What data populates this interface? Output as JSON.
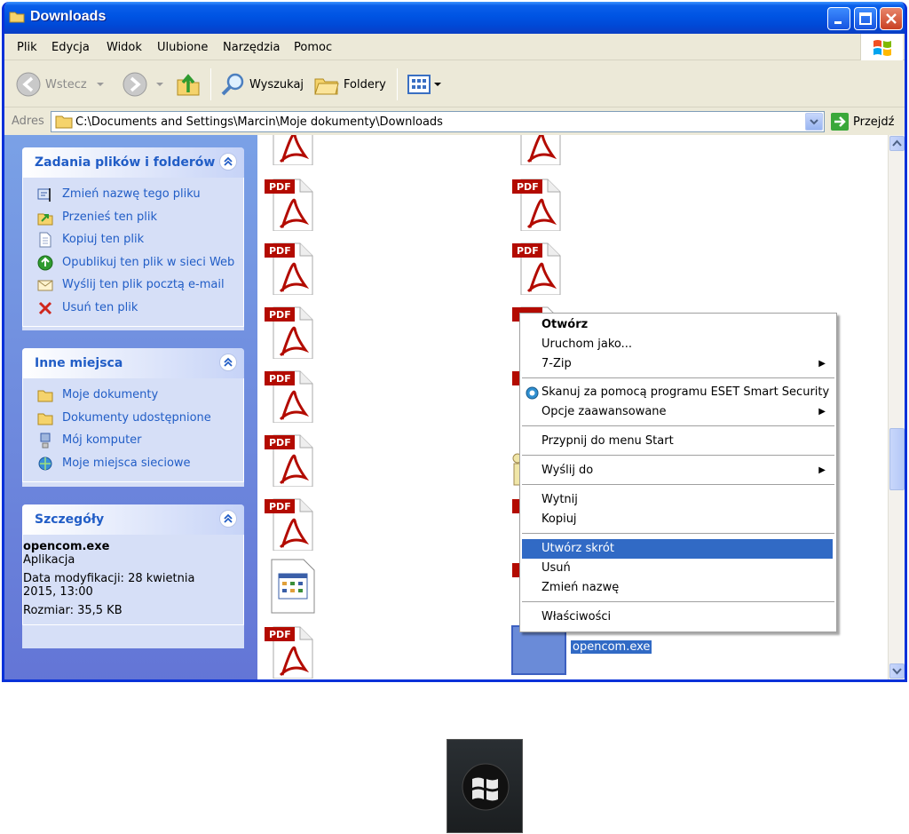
{
  "window": {
    "title": "Downloads"
  },
  "menu": {
    "items": [
      "Plik",
      "Edycja",
      "Widok",
      "Ulubione",
      "Narzędzia",
      "Pomoc"
    ]
  },
  "toolbar": {
    "back_label": "Wstecz",
    "search_label": "Wyszukaj",
    "folders_label": "Foldery"
  },
  "address": {
    "label": "Adres",
    "path": "C:\\Documents and Settings\\Marcin\\Moje dokumenty\\Downloads",
    "go_label": "Przejdź"
  },
  "tasks_panel": {
    "title": "Zadania plików i folderów",
    "items": [
      {
        "label": "Zmień nazwę tego pliku",
        "icon": "rename-icon"
      },
      {
        "label": "Przenieś ten plik",
        "icon": "move-icon"
      },
      {
        "label": "Kopiuj ten plik",
        "icon": "copy-icon"
      },
      {
        "label": "Opublikuj ten plik w sieci Web",
        "icon": "publish-web-icon"
      },
      {
        "label": "Wyślij ten plik pocztą e-mail",
        "icon": "email-icon"
      },
      {
        "label": "Usuń ten plik",
        "icon": "delete-icon"
      }
    ]
  },
  "places_panel": {
    "title": "Inne miejsca",
    "items": [
      {
        "label": "Moje dokumenty",
        "icon": "folder-icon"
      },
      {
        "label": "Dokumenty udostępnione",
        "icon": "folder-icon"
      },
      {
        "label": "Mój komputer",
        "icon": "computer-icon"
      },
      {
        "label": "Moje miejsca sieciowe",
        "icon": "network-icon"
      }
    ]
  },
  "details_panel": {
    "title": "Szczegóły",
    "filename": "opencom.exe",
    "type": "Aplikacja",
    "modified": "Data modyfikacji: 28 kwietnia 2015, 13:00",
    "size": "Rozmiar: 35,5 KB"
  },
  "files": {
    "pdf_badge": "PDF",
    "selected_label": "opencom.exe"
  },
  "context_menu": {
    "items": [
      {
        "label": "Otwórz",
        "bold": true
      },
      {
        "label": "Uruchom jako..."
      },
      {
        "label": "7-Zip",
        "submenu": true
      },
      {
        "label": "Skanuj za pomocą programu ESET Smart Security",
        "icon": "eset-icon"
      },
      {
        "label": "Opcje zaawansowane",
        "submenu": true
      },
      {
        "label": "Przypnij do menu Start"
      },
      {
        "label": "Wyślij do",
        "submenu": true
      },
      {
        "label": "Wytnij"
      },
      {
        "label": "Kopiuj"
      },
      {
        "label": "Utwórz skrót",
        "highlighted": true
      },
      {
        "label": "Usuń"
      },
      {
        "label": "Zmień nazwę"
      },
      {
        "label": "Właściwości"
      }
    ]
  },
  "colors": {
    "title_blue": "#0054e3",
    "task_link": "#215dc6",
    "highlight": "#316ac5",
    "pdf_red": "#b30b00"
  }
}
